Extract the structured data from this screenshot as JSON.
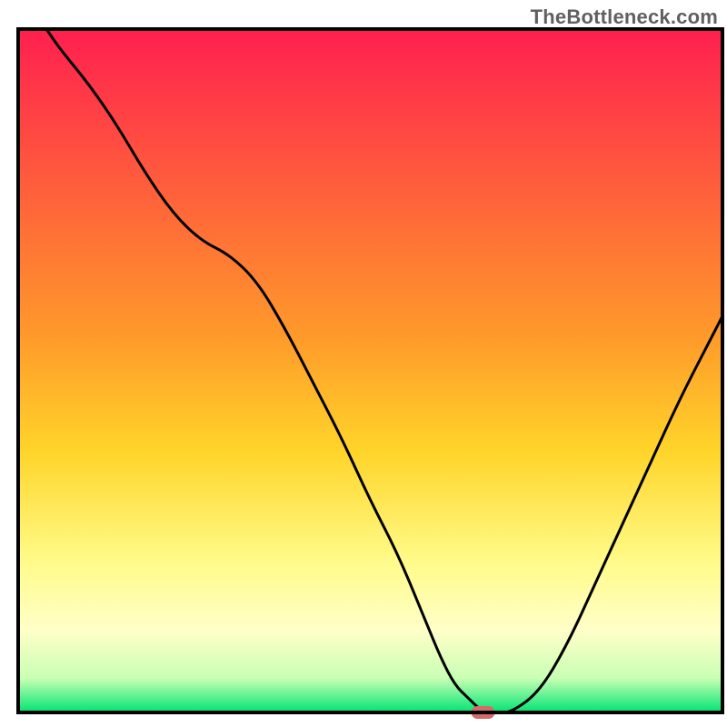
{
  "watermark": "TheBottleneck.com",
  "chart_data": {
    "type": "line",
    "title": "",
    "xlabel": "",
    "ylabel": "",
    "xlim": [
      0,
      100
    ],
    "ylim": [
      0,
      100
    ],
    "background_gradient": [
      {
        "offset": 0,
        "color": "#ff1f4f"
      },
      {
        "offset": 45,
        "color": "#ff9a2a"
      },
      {
        "offset": 62,
        "color": "#ffd52a"
      },
      {
        "offset": 78,
        "color": "#fffb8a"
      },
      {
        "offset": 88,
        "color": "#ffffc8"
      },
      {
        "offset": 95,
        "color": "#c9ffb4"
      },
      {
        "offset": 100,
        "color": "#00e472"
      }
    ],
    "series": [
      {
        "name": "bottleneck-curve",
        "type": "line",
        "color": "#000000",
        "x": [
          4,
          6,
          10,
          14,
          18,
          22,
          26,
          30,
          34,
          38,
          42,
          46,
          50,
          54,
          58,
          60,
          62,
          64,
          66,
          68,
          70,
          74,
          78,
          82,
          86,
          90,
          94,
          98,
          100
        ],
        "y": [
          100,
          97,
          92,
          86,
          79,
          73,
          69,
          67,
          63,
          56,
          48,
          40,
          31,
          23,
          13,
          8,
          4,
          2,
          0,
          0,
          0,
          3,
          10,
          19,
          28,
          37,
          46,
          54,
          58
        ]
      }
    ],
    "marker": {
      "name": "optimal-marker",
      "x": 66,
      "y": 0,
      "color": "#d46a6a",
      "width_ratio": 2.2
    },
    "axes_border": true
  }
}
